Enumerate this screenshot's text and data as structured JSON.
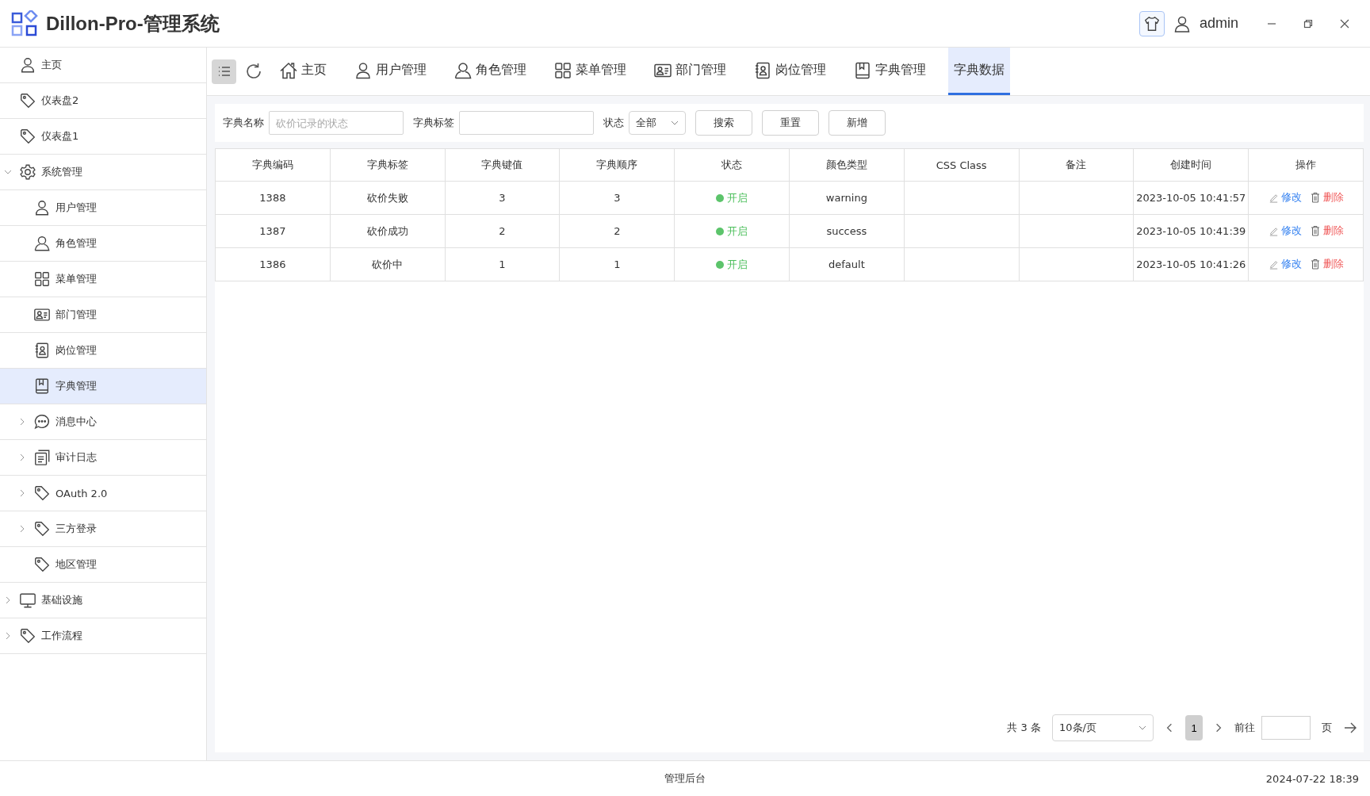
{
  "header": {
    "title": "Dillon-Pro-管理系统",
    "user": "admin"
  },
  "sidebar": {
    "items": [
      {
        "label": "主页",
        "selected": false
      },
      {
        "label": "仪表盘2",
        "selected": false
      },
      {
        "label": "仪表盘1",
        "selected": false
      },
      {
        "label": "系统管理",
        "selected": false,
        "expanded": true,
        "children": [
          {
            "label": "用户管理",
            "selected": false
          },
          {
            "label": "角色管理",
            "selected": false
          },
          {
            "label": "菜单管理",
            "selected": false
          },
          {
            "label": "部门管理",
            "selected": false
          },
          {
            "label": "岗位管理",
            "selected": false
          },
          {
            "label": "字典管理",
            "selected": true
          },
          {
            "label": "消息中心",
            "selected": false,
            "expanded": false
          },
          {
            "label": "审计日志",
            "selected": false,
            "expanded": false
          },
          {
            "label": "OAuth 2.0",
            "selected": false,
            "expanded": false
          },
          {
            "label": "三方登录",
            "selected": false,
            "expanded": false
          },
          {
            "label": "地区管理",
            "selected": false
          }
        ]
      },
      {
        "label": "基础设施",
        "selected": false,
        "expanded": false
      },
      {
        "label": "工作流程",
        "selected": false,
        "expanded": false
      }
    ]
  },
  "tabs": [
    {
      "label": "主页",
      "selected": false
    },
    {
      "label": "用户管理",
      "selected": false
    },
    {
      "label": "角色管理",
      "selected": false
    },
    {
      "label": "菜单管理",
      "selected": false
    },
    {
      "label": "部门管理",
      "selected": false
    },
    {
      "label": "岗位管理",
      "selected": false
    },
    {
      "label": "字典管理",
      "selected": false
    },
    {
      "label": "字典数据",
      "selected": true
    }
  ],
  "filters": {
    "name_label": "字典名称",
    "name_placeholder": "砍价记录的状态",
    "tag_label": "字典标签",
    "status_label": "状态",
    "status_value": "全部",
    "buttons": [
      "搜索",
      "重置",
      "新增"
    ]
  },
  "table": {
    "columns": [
      "字典编码",
      "字典标签",
      "字典键值",
      "字典顺序",
      "状态",
      "颜色类型",
      "CSS Class",
      "备注",
      "创建时间",
      "操作"
    ],
    "rows": [
      {
        "code": "1388",
        "label": "砍价失败",
        "value": "3",
        "order": "3",
        "status": "开启",
        "color_type": "warning",
        "created": "2023-10-05 10:41:57",
        "actions": [
          "修改",
          "删除"
        ]
      },
      {
        "code": "1387",
        "label": "砍价成功",
        "value": "2",
        "order": "2",
        "status": "开启",
        "color_type": "success",
        "created": "2023-10-05 10:41:39",
        "actions": [
          "修改",
          "删除"
        ]
      },
      {
        "code": "1386",
        "label": "砍价中",
        "value": "1",
        "order": "1",
        "status": "开启",
        "color_type": "default",
        "created": "2023-10-05 10:41:26",
        "actions": [
          "修改",
          "删除"
        ]
      }
    ]
  },
  "pagination": {
    "total": "共 3 条",
    "page_size": "10条/页",
    "pages": [
      {
        "label": "1",
        "selected": true
      }
    ],
    "goto_label": "前往",
    "page_unit": "页"
  },
  "footer": {
    "center": "管理后台",
    "datetime": "2024-07-22 18:39"
  }
}
